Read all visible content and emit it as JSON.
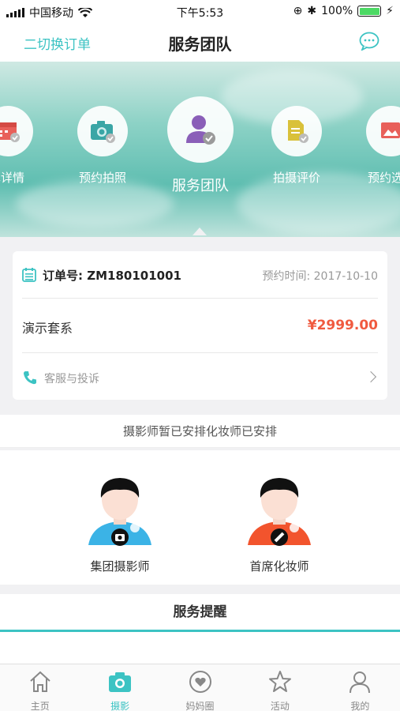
{
  "status_bar": {
    "carrier": "中国移动",
    "time": "下午5:53",
    "battery": "100%"
  },
  "nav": {
    "switch_label": "二切换订单",
    "title": "服务团队"
  },
  "banner_tabs": [
    {
      "label": "单详情"
    },
    {
      "label": "预约拍照"
    },
    {
      "label": "服务团队"
    },
    {
      "label": "拍摄评价"
    },
    {
      "label": "预约选"
    }
  ],
  "order": {
    "number": "订单号: ZM180101001",
    "time": "预约时间: 2017-10-10",
    "package": "演示套系",
    "price": "¥2999.00",
    "service_link": "客服与投诉"
  },
  "arrangement": "摄影师暂已安排化妆师已安排",
  "team": [
    {
      "name": "集团摄影师",
      "shirt_color": "#3bb3e6"
    },
    {
      "name": "首席化妆师",
      "shirt_color": "#f2542d"
    }
  ],
  "reminder_title": "服务提醒",
  "tabbar": [
    {
      "label": "主页",
      "icon": "home-icon"
    },
    {
      "label": "摄影",
      "icon": "camera-icon"
    },
    {
      "label": "妈妈圈",
      "icon": "heart-circle-icon"
    },
    {
      "label": "活动",
      "icon": "star-icon"
    },
    {
      "label": "我的",
      "icon": "person-icon"
    }
  ],
  "colors": {
    "accent": "#3cc3c3",
    "price": "#f05a3f"
  }
}
